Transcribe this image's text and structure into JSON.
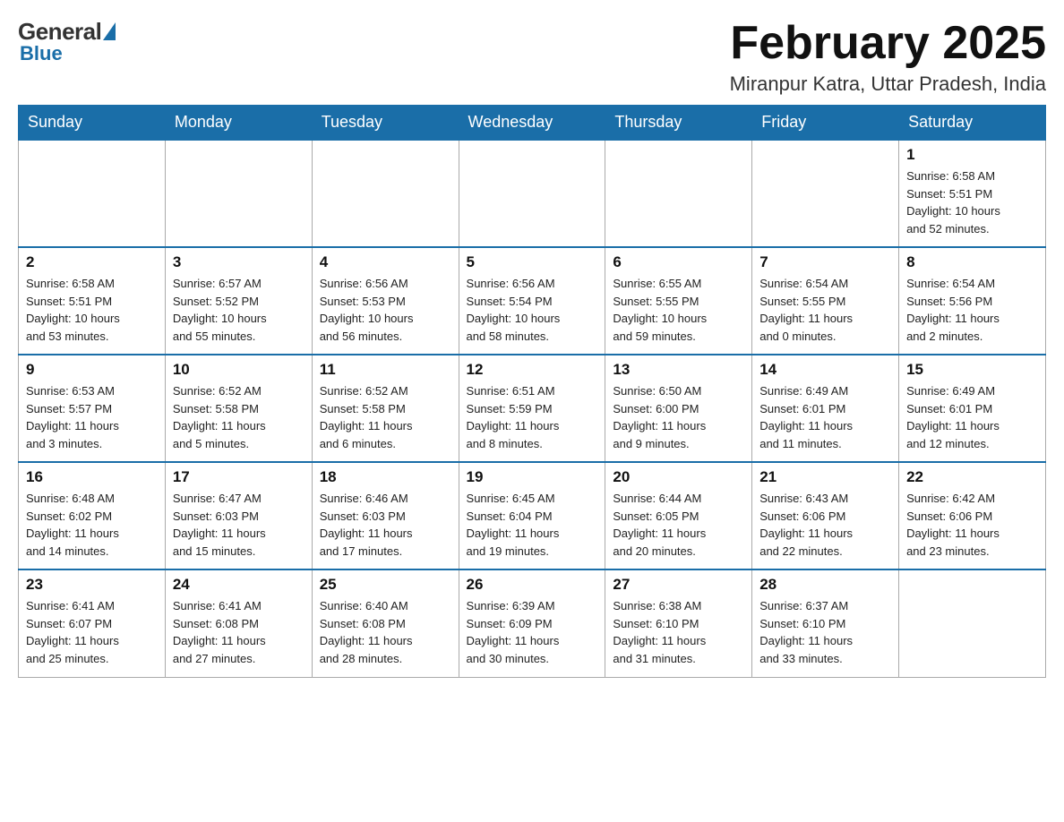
{
  "logo": {
    "general": "General",
    "blue": "Blue"
  },
  "title": "February 2025",
  "location": "Miranpur Katra, Uttar Pradesh, India",
  "days_of_week": [
    "Sunday",
    "Monday",
    "Tuesday",
    "Wednesday",
    "Thursday",
    "Friday",
    "Saturday"
  ],
  "weeks": [
    [
      {
        "day": "",
        "info": ""
      },
      {
        "day": "",
        "info": ""
      },
      {
        "day": "",
        "info": ""
      },
      {
        "day": "",
        "info": ""
      },
      {
        "day": "",
        "info": ""
      },
      {
        "day": "",
        "info": ""
      },
      {
        "day": "1",
        "info": "Sunrise: 6:58 AM\nSunset: 5:51 PM\nDaylight: 10 hours\nand 52 minutes."
      }
    ],
    [
      {
        "day": "2",
        "info": "Sunrise: 6:58 AM\nSunset: 5:51 PM\nDaylight: 10 hours\nand 53 minutes."
      },
      {
        "day": "3",
        "info": "Sunrise: 6:57 AM\nSunset: 5:52 PM\nDaylight: 10 hours\nand 55 minutes."
      },
      {
        "day": "4",
        "info": "Sunrise: 6:56 AM\nSunset: 5:53 PM\nDaylight: 10 hours\nand 56 minutes."
      },
      {
        "day": "5",
        "info": "Sunrise: 6:56 AM\nSunset: 5:54 PM\nDaylight: 10 hours\nand 58 minutes."
      },
      {
        "day": "6",
        "info": "Sunrise: 6:55 AM\nSunset: 5:55 PM\nDaylight: 10 hours\nand 59 minutes."
      },
      {
        "day": "7",
        "info": "Sunrise: 6:54 AM\nSunset: 5:55 PM\nDaylight: 11 hours\nand 0 minutes."
      },
      {
        "day": "8",
        "info": "Sunrise: 6:54 AM\nSunset: 5:56 PM\nDaylight: 11 hours\nand 2 minutes."
      }
    ],
    [
      {
        "day": "9",
        "info": "Sunrise: 6:53 AM\nSunset: 5:57 PM\nDaylight: 11 hours\nand 3 minutes."
      },
      {
        "day": "10",
        "info": "Sunrise: 6:52 AM\nSunset: 5:58 PM\nDaylight: 11 hours\nand 5 minutes."
      },
      {
        "day": "11",
        "info": "Sunrise: 6:52 AM\nSunset: 5:58 PM\nDaylight: 11 hours\nand 6 minutes."
      },
      {
        "day": "12",
        "info": "Sunrise: 6:51 AM\nSunset: 5:59 PM\nDaylight: 11 hours\nand 8 minutes."
      },
      {
        "day": "13",
        "info": "Sunrise: 6:50 AM\nSunset: 6:00 PM\nDaylight: 11 hours\nand 9 minutes."
      },
      {
        "day": "14",
        "info": "Sunrise: 6:49 AM\nSunset: 6:01 PM\nDaylight: 11 hours\nand 11 minutes."
      },
      {
        "day": "15",
        "info": "Sunrise: 6:49 AM\nSunset: 6:01 PM\nDaylight: 11 hours\nand 12 minutes."
      }
    ],
    [
      {
        "day": "16",
        "info": "Sunrise: 6:48 AM\nSunset: 6:02 PM\nDaylight: 11 hours\nand 14 minutes."
      },
      {
        "day": "17",
        "info": "Sunrise: 6:47 AM\nSunset: 6:03 PM\nDaylight: 11 hours\nand 15 minutes."
      },
      {
        "day": "18",
        "info": "Sunrise: 6:46 AM\nSunset: 6:03 PM\nDaylight: 11 hours\nand 17 minutes."
      },
      {
        "day": "19",
        "info": "Sunrise: 6:45 AM\nSunset: 6:04 PM\nDaylight: 11 hours\nand 19 minutes."
      },
      {
        "day": "20",
        "info": "Sunrise: 6:44 AM\nSunset: 6:05 PM\nDaylight: 11 hours\nand 20 minutes."
      },
      {
        "day": "21",
        "info": "Sunrise: 6:43 AM\nSunset: 6:06 PM\nDaylight: 11 hours\nand 22 minutes."
      },
      {
        "day": "22",
        "info": "Sunrise: 6:42 AM\nSunset: 6:06 PM\nDaylight: 11 hours\nand 23 minutes."
      }
    ],
    [
      {
        "day": "23",
        "info": "Sunrise: 6:41 AM\nSunset: 6:07 PM\nDaylight: 11 hours\nand 25 minutes."
      },
      {
        "day": "24",
        "info": "Sunrise: 6:41 AM\nSunset: 6:08 PM\nDaylight: 11 hours\nand 27 minutes."
      },
      {
        "day": "25",
        "info": "Sunrise: 6:40 AM\nSunset: 6:08 PM\nDaylight: 11 hours\nand 28 minutes."
      },
      {
        "day": "26",
        "info": "Sunrise: 6:39 AM\nSunset: 6:09 PM\nDaylight: 11 hours\nand 30 minutes."
      },
      {
        "day": "27",
        "info": "Sunrise: 6:38 AM\nSunset: 6:10 PM\nDaylight: 11 hours\nand 31 minutes."
      },
      {
        "day": "28",
        "info": "Sunrise: 6:37 AM\nSunset: 6:10 PM\nDaylight: 11 hours\nand 33 minutes."
      },
      {
        "day": "",
        "info": ""
      }
    ]
  ]
}
